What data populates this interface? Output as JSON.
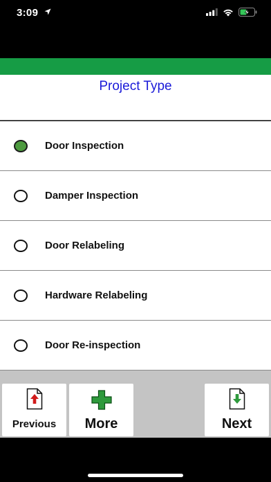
{
  "status_bar": {
    "time": "3:09",
    "icons": [
      "location-arrow-icon",
      "cellular-signal-icon",
      "wifi-icon",
      "battery-charging-icon"
    ]
  },
  "colors": {
    "header_band": "#169c45",
    "title": "#1a1ad8",
    "selected_radio": "#4d9a3f",
    "toolbar_bg": "#c4c4c4"
  },
  "header": {
    "title": "Project Type"
  },
  "options": [
    {
      "label": "Door Inspection",
      "selected": true
    },
    {
      "label": "Damper Inspection",
      "selected": false
    },
    {
      "label": "Door Relabeling",
      "selected": false
    },
    {
      "label": "Hardware Relabeling",
      "selected": false
    },
    {
      "label": "Door Re-inspection",
      "selected": false
    }
  ],
  "toolbar": {
    "previous_label": "Previous",
    "more_label": "More",
    "next_label": "Next"
  }
}
